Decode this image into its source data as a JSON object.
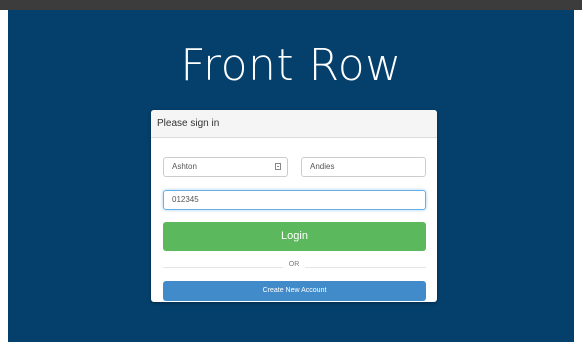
{
  "app": {
    "title": "Front Row"
  },
  "signin": {
    "heading": "Please sign in",
    "first_name_value": "Ashton",
    "last_name_value": "Andies",
    "code_value": "012345",
    "login_label": "Login",
    "or_label": "OR",
    "create_account_label": "Create New Account"
  },
  "icons": {
    "first_name_field_icon": "id-card-icon"
  },
  "colors": {
    "page_background": "#053f6b",
    "login_button": "#5cb85c",
    "create_account_button": "#428bca",
    "panel_background": "#ffffff"
  }
}
